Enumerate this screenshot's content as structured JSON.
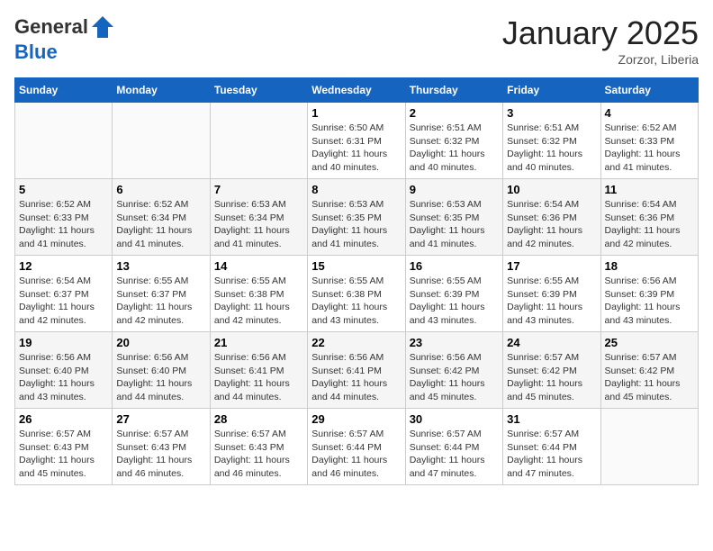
{
  "header": {
    "logo_line1": "General",
    "logo_line2": "Blue",
    "month_title": "January 2025",
    "location": "Zorzor, Liberia"
  },
  "weekdays": [
    "Sunday",
    "Monday",
    "Tuesday",
    "Wednesday",
    "Thursday",
    "Friday",
    "Saturday"
  ],
  "weeks": [
    [
      {
        "day": "",
        "info": ""
      },
      {
        "day": "",
        "info": ""
      },
      {
        "day": "",
        "info": ""
      },
      {
        "day": "1",
        "info": "Sunrise: 6:50 AM\nSunset: 6:31 PM\nDaylight: 11 hours and 40 minutes."
      },
      {
        "day": "2",
        "info": "Sunrise: 6:51 AM\nSunset: 6:32 PM\nDaylight: 11 hours and 40 minutes."
      },
      {
        "day": "3",
        "info": "Sunrise: 6:51 AM\nSunset: 6:32 PM\nDaylight: 11 hours and 40 minutes."
      },
      {
        "day": "4",
        "info": "Sunrise: 6:52 AM\nSunset: 6:33 PM\nDaylight: 11 hours and 41 minutes."
      }
    ],
    [
      {
        "day": "5",
        "info": "Sunrise: 6:52 AM\nSunset: 6:33 PM\nDaylight: 11 hours and 41 minutes."
      },
      {
        "day": "6",
        "info": "Sunrise: 6:52 AM\nSunset: 6:34 PM\nDaylight: 11 hours and 41 minutes."
      },
      {
        "day": "7",
        "info": "Sunrise: 6:53 AM\nSunset: 6:34 PM\nDaylight: 11 hours and 41 minutes."
      },
      {
        "day": "8",
        "info": "Sunrise: 6:53 AM\nSunset: 6:35 PM\nDaylight: 11 hours and 41 minutes."
      },
      {
        "day": "9",
        "info": "Sunrise: 6:53 AM\nSunset: 6:35 PM\nDaylight: 11 hours and 41 minutes."
      },
      {
        "day": "10",
        "info": "Sunrise: 6:54 AM\nSunset: 6:36 PM\nDaylight: 11 hours and 42 minutes."
      },
      {
        "day": "11",
        "info": "Sunrise: 6:54 AM\nSunset: 6:36 PM\nDaylight: 11 hours and 42 minutes."
      }
    ],
    [
      {
        "day": "12",
        "info": "Sunrise: 6:54 AM\nSunset: 6:37 PM\nDaylight: 11 hours and 42 minutes."
      },
      {
        "day": "13",
        "info": "Sunrise: 6:55 AM\nSunset: 6:37 PM\nDaylight: 11 hours and 42 minutes."
      },
      {
        "day": "14",
        "info": "Sunrise: 6:55 AM\nSunset: 6:38 PM\nDaylight: 11 hours and 42 minutes."
      },
      {
        "day": "15",
        "info": "Sunrise: 6:55 AM\nSunset: 6:38 PM\nDaylight: 11 hours and 43 minutes."
      },
      {
        "day": "16",
        "info": "Sunrise: 6:55 AM\nSunset: 6:39 PM\nDaylight: 11 hours and 43 minutes."
      },
      {
        "day": "17",
        "info": "Sunrise: 6:55 AM\nSunset: 6:39 PM\nDaylight: 11 hours and 43 minutes."
      },
      {
        "day": "18",
        "info": "Sunrise: 6:56 AM\nSunset: 6:39 PM\nDaylight: 11 hours and 43 minutes."
      }
    ],
    [
      {
        "day": "19",
        "info": "Sunrise: 6:56 AM\nSunset: 6:40 PM\nDaylight: 11 hours and 43 minutes."
      },
      {
        "day": "20",
        "info": "Sunrise: 6:56 AM\nSunset: 6:40 PM\nDaylight: 11 hours and 44 minutes."
      },
      {
        "day": "21",
        "info": "Sunrise: 6:56 AM\nSunset: 6:41 PM\nDaylight: 11 hours and 44 minutes."
      },
      {
        "day": "22",
        "info": "Sunrise: 6:56 AM\nSunset: 6:41 PM\nDaylight: 11 hours and 44 minutes."
      },
      {
        "day": "23",
        "info": "Sunrise: 6:56 AM\nSunset: 6:42 PM\nDaylight: 11 hours and 45 minutes."
      },
      {
        "day": "24",
        "info": "Sunrise: 6:57 AM\nSunset: 6:42 PM\nDaylight: 11 hours and 45 minutes."
      },
      {
        "day": "25",
        "info": "Sunrise: 6:57 AM\nSunset: 6:42 PM\nDaylight: 11 hours and 45 minutes."
      }
    ],
    [
      {
        "day": "26",
        "info": "Sunrise: 6:57 AM\nSunset: 6:43 PM\nDaylight: 11 hours and 45 minutes."
      },
      {
        "day": "27",
        "info": "Sunrise: 6:57 AM\nSunset: 6:43 PM\nDaylight: 11 hours and 46 minutes."
      },
      {
        "day": "28",
        "info": "Sunrise: 6:57 AM\nSunset: 6:43 PM\nDaylight: 11 hours and 46 minutes."
      },
      {
        "day": "29",
        "info": "Sunrise: 6:57 AM\nSunset: 6:44 PM\nDaylight: 11 hours and 46 minutes."
      },
      {
        "day": "30",
        "info": "Sunrise: 6:57 AM\nSunset: 6:44 PM\nDaylight: 11 hours and 47 minutes."
      },
      {
        "day": "31",
        "info": "Sunrise: 6:57 AM\nSunset: 6:44 PM\nDaylight: 11 hours and 47 minutes."
      },
      {
        "day": "",
        "info": ""
      }
    ]
  ]
}
